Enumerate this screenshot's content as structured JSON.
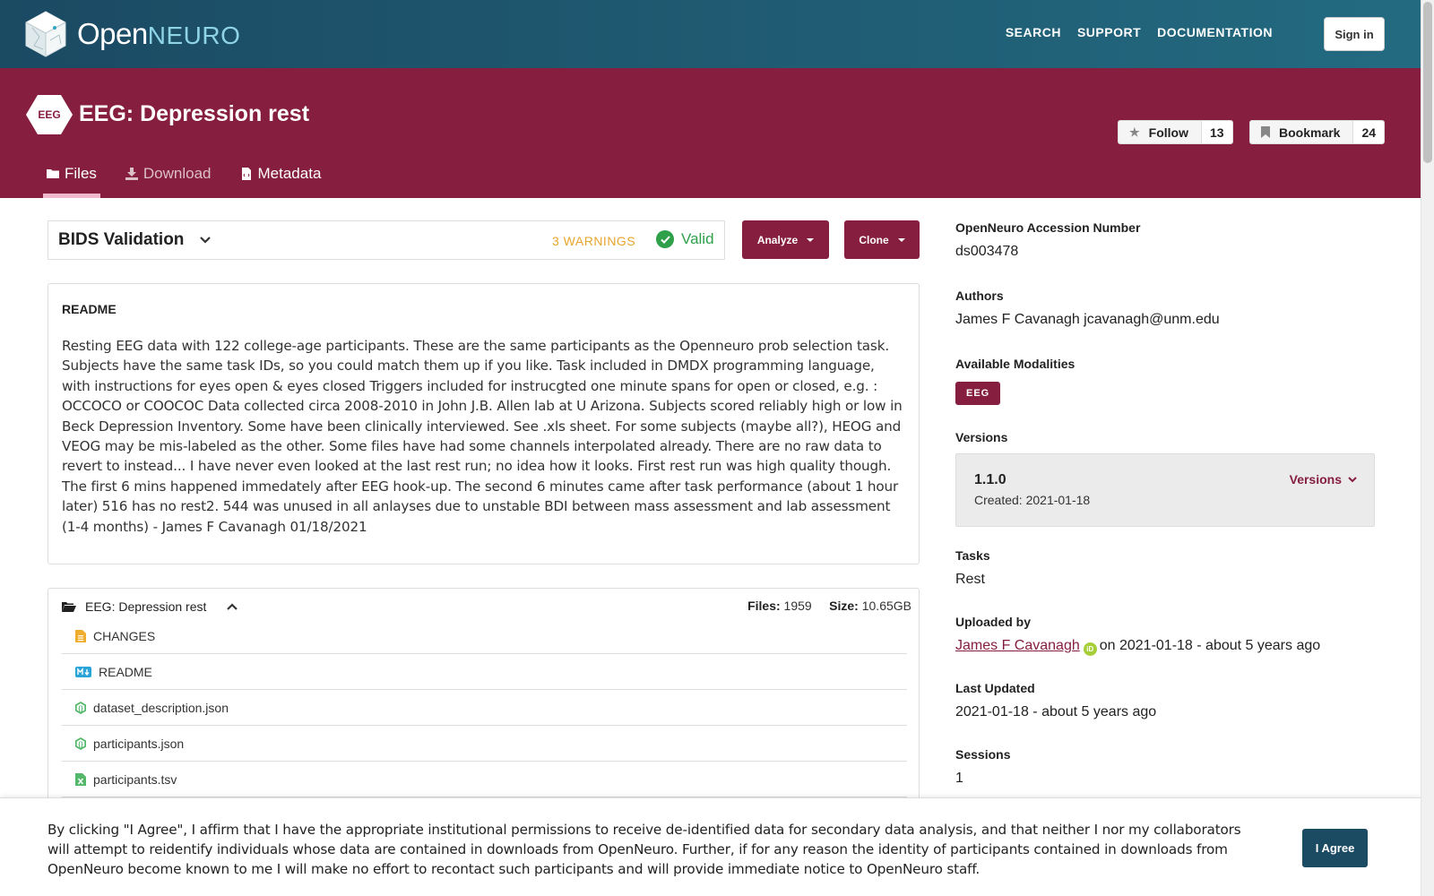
{
  "nav": {
    "logo_open": "Open",
    "logo_neuro": "NEURO",
    "links": [
      "SEARCH",
      "SUPPORT",
      "DOCUMENTATION"
    ],
    "sign_in": "Sign in"
  },
  "dataset": {
    "modality_badge": "EEG",
    "title": "EEG: Depression rest",
    "follow_label": "Follow",
    "follow_count": "13",
    "bookmark_label": "Bookmark",
    "bookmark_count": "24",
    "tabs": [
      "Files",
      "Download",
      "Metadata"
    ]
  },
  "bids": {
    "title": "BIDS Validation",
    "warnings": "3 WARNINGS",
    "status": "Valid"
  },
  "buttons": {
    "analyze": "Analyze",
    "clone": "Clone"
  },
  "readme": {
    "heading": "README",
    "text": "Resting EEG data with 122 college-age participants. These are the same participants as the Openneuro prob selection task. Subjects have the same task IDs, so you could match them up if you like. Task included in DMDX programming language, with instructions for eyes open & eyes closed Triggers included for instrucgted one minute spans for open or closed, e.g. : OCCOCO or COOCOC Data collected circa 2008-2010 in John J.B. Allen lab at U Arizona. Subjects scored reliably high or low in Beck Depression Inventory. Some have been clinically interviewed. See .xls sheet. For some subjects (maybe all?), HEOG and VEOG may be mis-labeled as the other. Some files have had some channels interpolated already. There are no raw data to revert to instead... I have never even looked at the last rest run; no idea how it looks. First rest run was high quality though. The first 6 mins happened immedately after EEG hook-up. The second 6 minutes came after task performance (about 1 hour later) 516 has no rest2. 544 was unused in all anlayses due to unstable BDI between mass assessment and lab assessment (1-4 months) - James F Cavanagh 01/18/2021"
  },
  "files": {
    "root": "EEG: Depression rest",
    "files_label": "Files:",
    "files_count": "1959",
    "size_label": "Size:",
    "size_value": "10.65GB",
    "items": [
      {
        "name": "CHANGES",
        "icon": "file-text-icon",
        "color": "#f0ad2e"
      },
      {
        "name": "README",
        "icon": "markdown-icon",
        "color": "#2aa3d8"
      },
      {
        "name": "dataset_description.json",
        "icon": "json-file-icon",
        "color": "#53b86a"
      },
      {
        "name": "participants.json",
        "icon": "json-file-icon",
        "color": "#53b86a"
      },
      {
        "name": "participants.tsv",
        "icon": "spreadsheet-file-icon",
        "color": "#53b86a"
      }
    ]
  },
  "sidebar": {
    "accession_label": "OpenNeuro Accession Number",
    "accession_value": "ds003478",
    "authors_label": "Authors",
    "authors_value": "James F Cavanagh jcavanagh@unm.edu",
    "modalities_label": "Available Modalities",
    "modality": "EEG",
    "versions_label": "Versions",
    "version_number": "1.1.0",
    "version_created": "Created: 2021-01-18",
    "versions_link": "Versions",
    "tasks_label": "Tasks",
    "tasks_value": "Rest",
    "uploaded_label": "Uploaded by",
    "uploader": "James F Cavanagh",
    "uploaded_suffix": "on 2021-01-18 - about 5 years ago",
    "updated_label": "Last Updated",
    "updated_value": "2021-01-18 - about 5 years ago",
    "sessions_label": "Sessions",
    "sessions_value": "1"
  },
  "agreement": {
    "text": "By clicking \"I Agree\", I affirm that I have the appropriate institutional permissions to receive de-identified data for secondary data analysis, and that neither I nor my collaborators will attempt to reidentify individuals whose data are contained in downloads from OpenNeuro. Further, if for any reason the identity of participants contained in downloads from OpenNeuro become known to me I will make no effort to recontact such participants and will provide immediate notice to OpenNeuro staff.",
    "button": "I Agree"
  },
  "colors": {
    "nav_bg": "#1b4a63",
    "header_bg": "#861f3f",
    "valid": "#2fa04a",
    "warning": "#e7a52d"
  }
}
